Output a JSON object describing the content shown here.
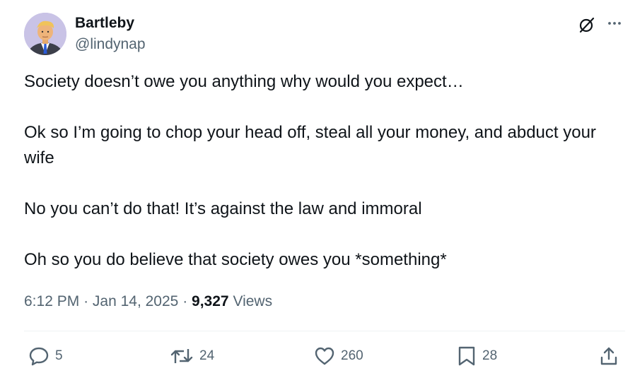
{
  "author": {
    "display_name": "Bartleby",
    "handle": "@lindynap"
  },
  "header_icons": {
    "grok": "grok-icon",
    "more": "more-horizontal-icon"
  },
  "tweet": {
    "paragraphs": [
      "Society doesn’t owe you anything why would you expect…",
      "Ok so I’m going to chop your head off, steal all your money, and abduct your wife",
      "No you can’t do that! It’s against the law and immoral",
      "Oh so you do believe that society owes you *something*"
    ]
  },
  "meta": {
    "time": "6:12 PM",
    "separator": "·",
    "date": "Jan 14, 2025",
    "views_count": "9,327",
    "views_label": "Views"
  },
  "actions": {
    "replies": "5",
    "reposts": "24",
    "likes": "260",
    "bookmarks": "28"
  },
  "colors": {
    "text_primary": "#0f1419",
    "text_secondary": "#536471",
    "divider": "#eff3f4",
    "avatar_bg": "#c9c3e6"
  }
}
